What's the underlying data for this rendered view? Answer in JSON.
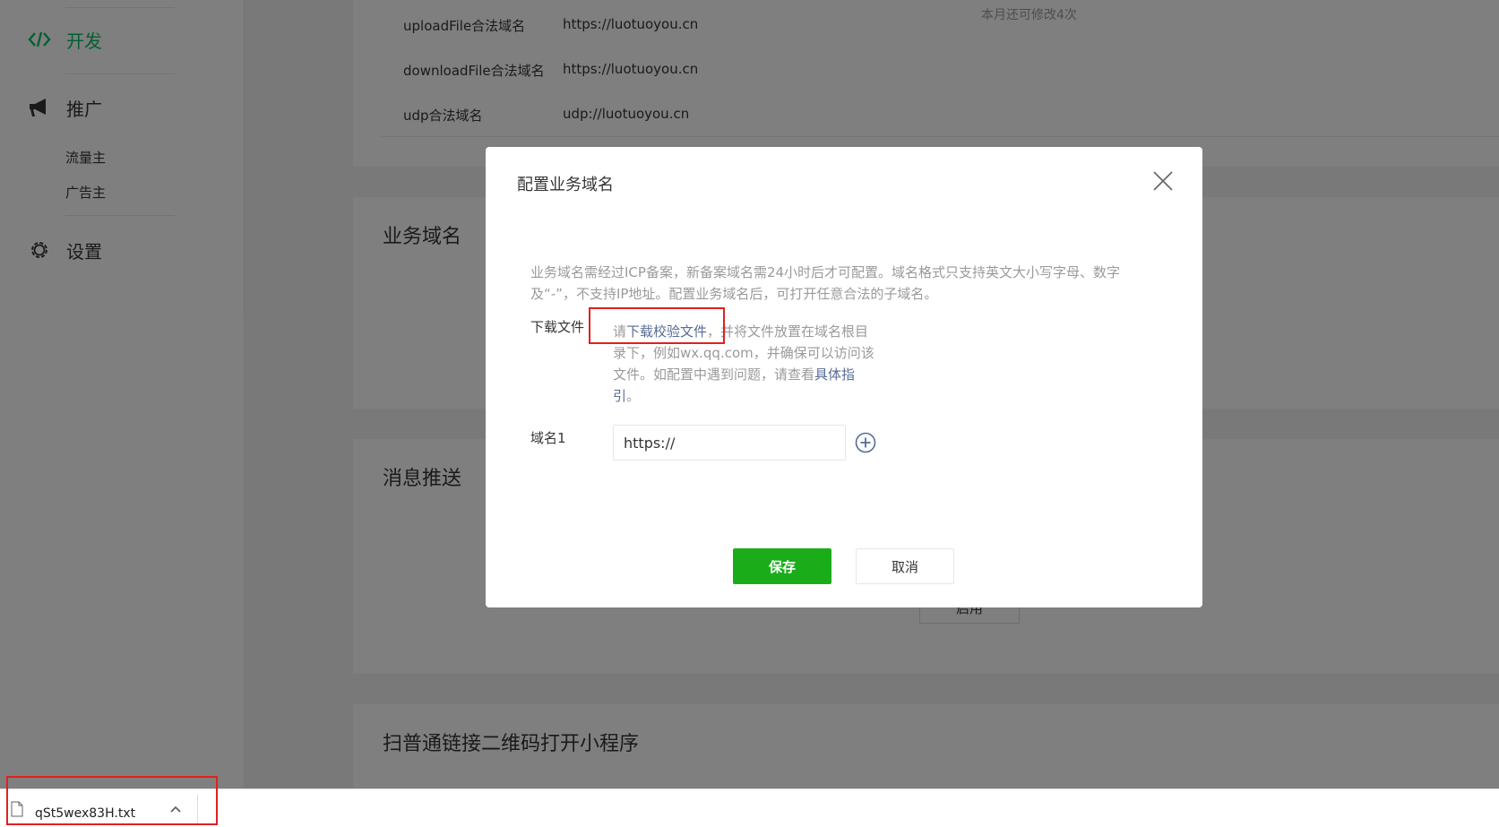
{
  "sidebar": {
    "items": [
      {
        "label": "开发",
        "icon": "code-icon",
        "active": true
      },
      {
        "label": "推广",
        "icon": "megaphone-icon"
      },
      {
        "label": "设置",
        "icon": "gear-icon"
      }
    ],
    "sub_items": [
      "流量主",
      "广告主"
    ]
  },
  "server_domains": {
    "rows": [
      {
        "label": "uploadFile合法域名",
        "value": "https://luotuoyou.cn"
      },
      {
        "label": "downloadFile合法域名",
        "value": "https://luotuoyou.cn"
      },
      {
        "label": "udp合法域名",
        "value": "udp://luotuoyou.cn"
      }
    ],
    "note": "本月还可修改4次"
  },
  "sections": {
    "business_domain": "业务域名",
    "message_push": "消息推送",
    "qrcode": "扫普通链接二维码打开小程序"
  },
  "hidden_button": "启用",
  "modal": {
    "title": "配置业务域名",
    "description": "业务域名需经过ICP备案，新备案域名需24小时后才可配置。域名格式只支持英文大小写字母、数字及“-”，不支持IP地址。配置业务域名后，可打开任意合法的子域名。",
    "download_label": "下载文件",
    "download_prefix": "请",
    "download_link": "下载校验文件",
    "download_middle": "，并将文件放置在域名根目录下，例如wx.qq.com，并确保可以访问该文件。如配置中遇到问题，请查看",
    "guide_link": "具体指引",
    "download_suffix": "。",
    "domain_label": "域名1",
    "domain_value": "https://",
    "save": "保存",
    "cancel": "取消"
  },
  "download_bar": {
    "filename": "qSt5wex83H.txt"
  },
  "colors": {
    "accent_green": "#07c160",
    "save_green": "#1aad19",
    "link_blue": "#576b95",
    "highlight_red": "#e02020"
  }
}
